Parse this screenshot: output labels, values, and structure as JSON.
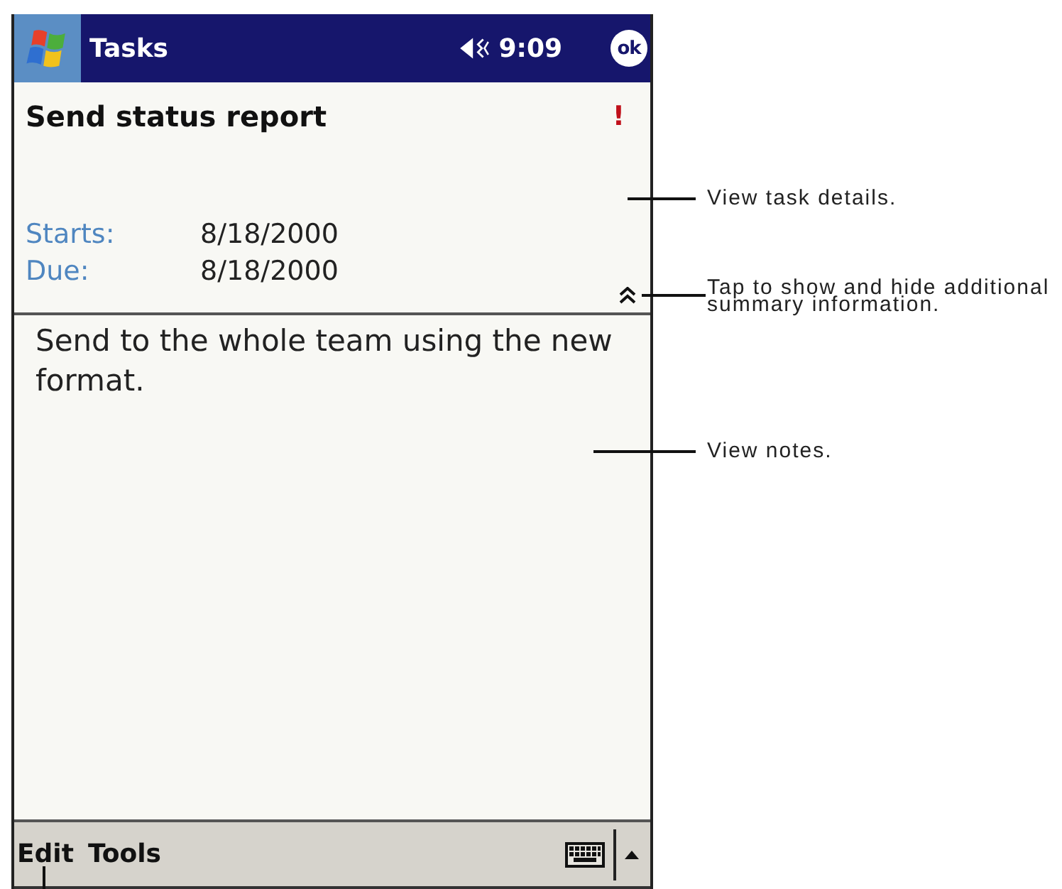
{
  "title_bar": {
    "title": "Tasks",
    "time": "9:09",
    "ok": "ok"
  },
  "task": {
    "subject": "Send status report",
    "priority": "!",
    "expanded": true,
    "fields": [
      {
        "label": "Starts:",
        "value": "8/18/2000"
      },
      {
        "label": "Due:",
        "value": "8/18/2000"
      }
    ],
    "notes": "Send to the whole team using the new format."
  },
  "menu_bar": {
    "items": [
      "Edit",
      "Tools"
    ]
  },
  "callouts": [
    "View task details.",
    "Tap to show and hide additional summary information.",
    "View notes."
  ]
}
